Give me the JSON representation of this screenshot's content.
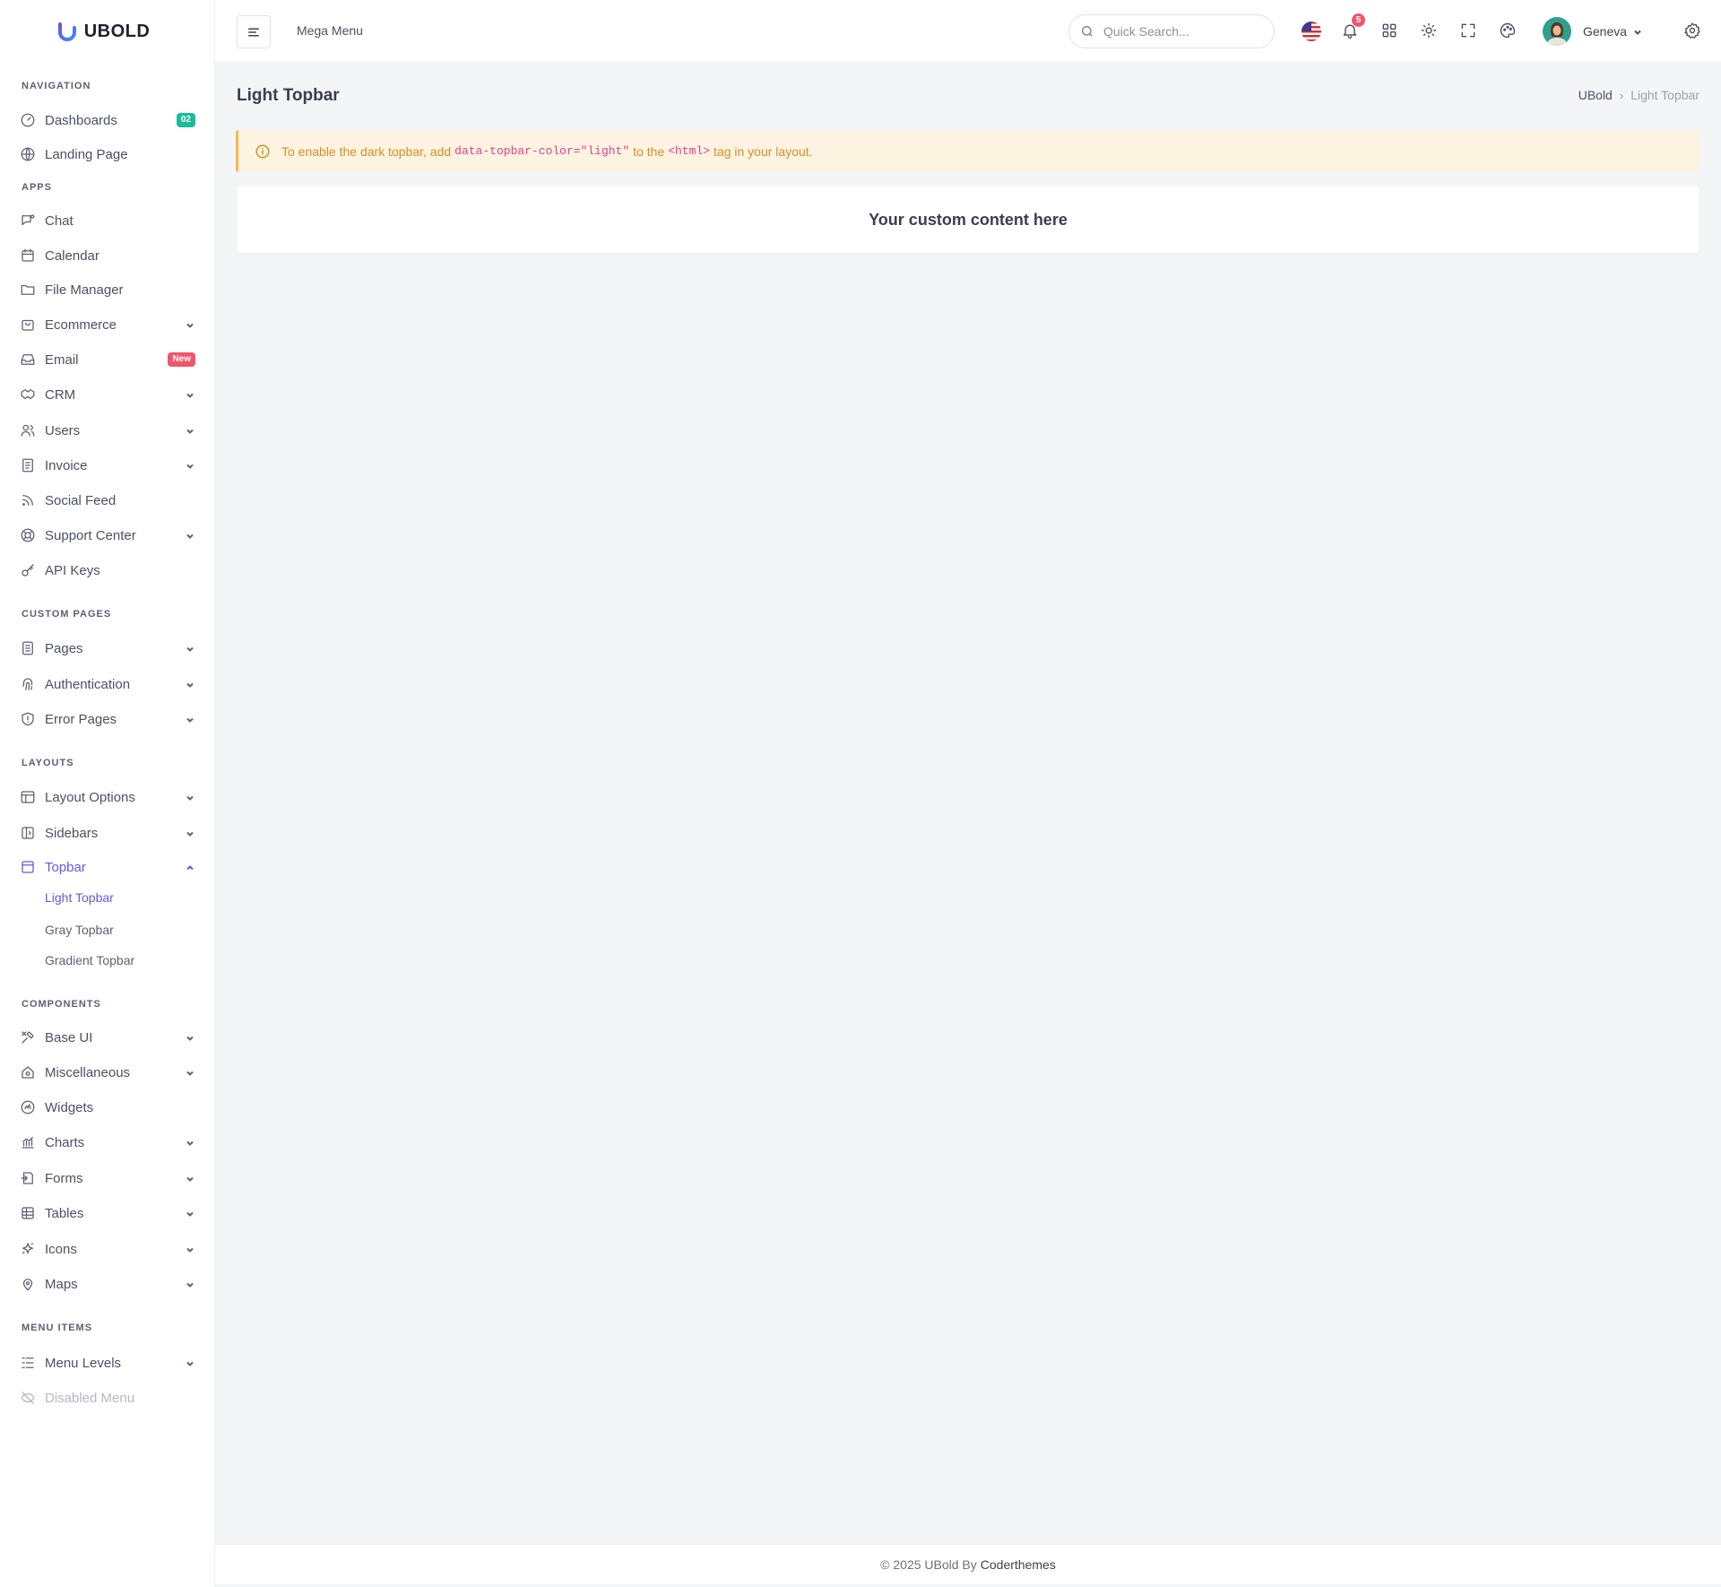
{
  "brand": {
    "name": "UBOLD"
  },
  "topbar": {
    "mega_menu": "Mega Menu",
    "search_placeholder": "Quick Search...",
    "notification_count": "5",
    "user_name": "Geneva"
  },
  "sidebar": {
    "sections": {
      "navigation": "Navigation",
      "apps": "Apps",
      "custom_pages": "Custom Pages",
      "layouts": "Layouts",
      "components": "Components",
      "menu_items": "Menu Items"
    },
    "items": {
      "dashboards": {
        "label": "Dashboards",
        "badge": "02"
      },
      "landing": {
        "label": "Landing Page"
      },
      "chat": {
        "label": "Chat"
      },
      "calendar": {
        "label": "Calendar"
      },
      "file_manager": {
        "label": "File Manager"
      },
      "ecommerce": {
        "label": "Ecommerce"
      },
      "email": {
        "label": "Email",
        "badge": "New"
      },
      "crm": {
        "label": "CRM"
      },
      "users": {
        "label": "Users"
      },
      "invoice": {
        "label": "Invoice"
      },
      "social_feed": {
        "label": "Social Feed"
      },
      "support": {
        "label": "Support Center"
      },
      "api_keys": {
        "label": "API Keys"
      },
      "pages": {
        "label": "Pages"
      },
      "authentication": {
        "label": "Authentication"
      },
      "error_pages": {
        "label": "Error Pages"
      },
      "layout_options": {
        "label": "Layout Options"
      },
      "sidebars": {
        "label": "Sidebars"
      },
      "topbar": {
        "label": "Topbar"
      },
      "light_topbar": {
        "label": "Light Topbar"
      },
      "gray_topbar": {
        "label": "Gray Topbar"
      },
      "gradient_topbar": {
        "label": "Gradient Topbar"
      },
      "base_ui": {
        "label": "Base UI"
      },
      "misc": {
        "label": "Miscellaneous"
      },
      "widgets": {
        "label": "Widgets"
      },
      "charts": {
        "label": "Charts"
      },
      "forms": {
        "label": "Forms"
      },
      "tables": {
        "label": "Tables"
      },
      "icons": {
        "label": "Icons"
      },
      "maps": {
        "label": "Maps"
      },
      "menu_levels": {
        "label": "Menu Levels"
      },
      "disabled": {
        "label": "Disabled Menu"
      }
    }
  },
  "main": {
    "title": "Light Topbar",
    "breadcrumb": {
      "root": "UBold",
      "separator": "›",
      "current": "Light Topbar"
    },
    "alert": {
      "prefix": "To enable the dark topbar, add",
      "attr_code": "data-topbar-color=\"light\"",
      "middle": "to the",
      "tag_code": "<html>",
      "suffix": "tag in your layout."
    },
    "card_text": "Your custom content here"
  },
  "footer": {
    "copyright": "© 2025 UBold By",
    "company": "Coderthemes"
  },
  "colors": {
    "accent": "#6658dd",
    "teal": "#1abc9c",
    "danger": "#f1556c",
    "warning": "#f7b84b"
  }
}
